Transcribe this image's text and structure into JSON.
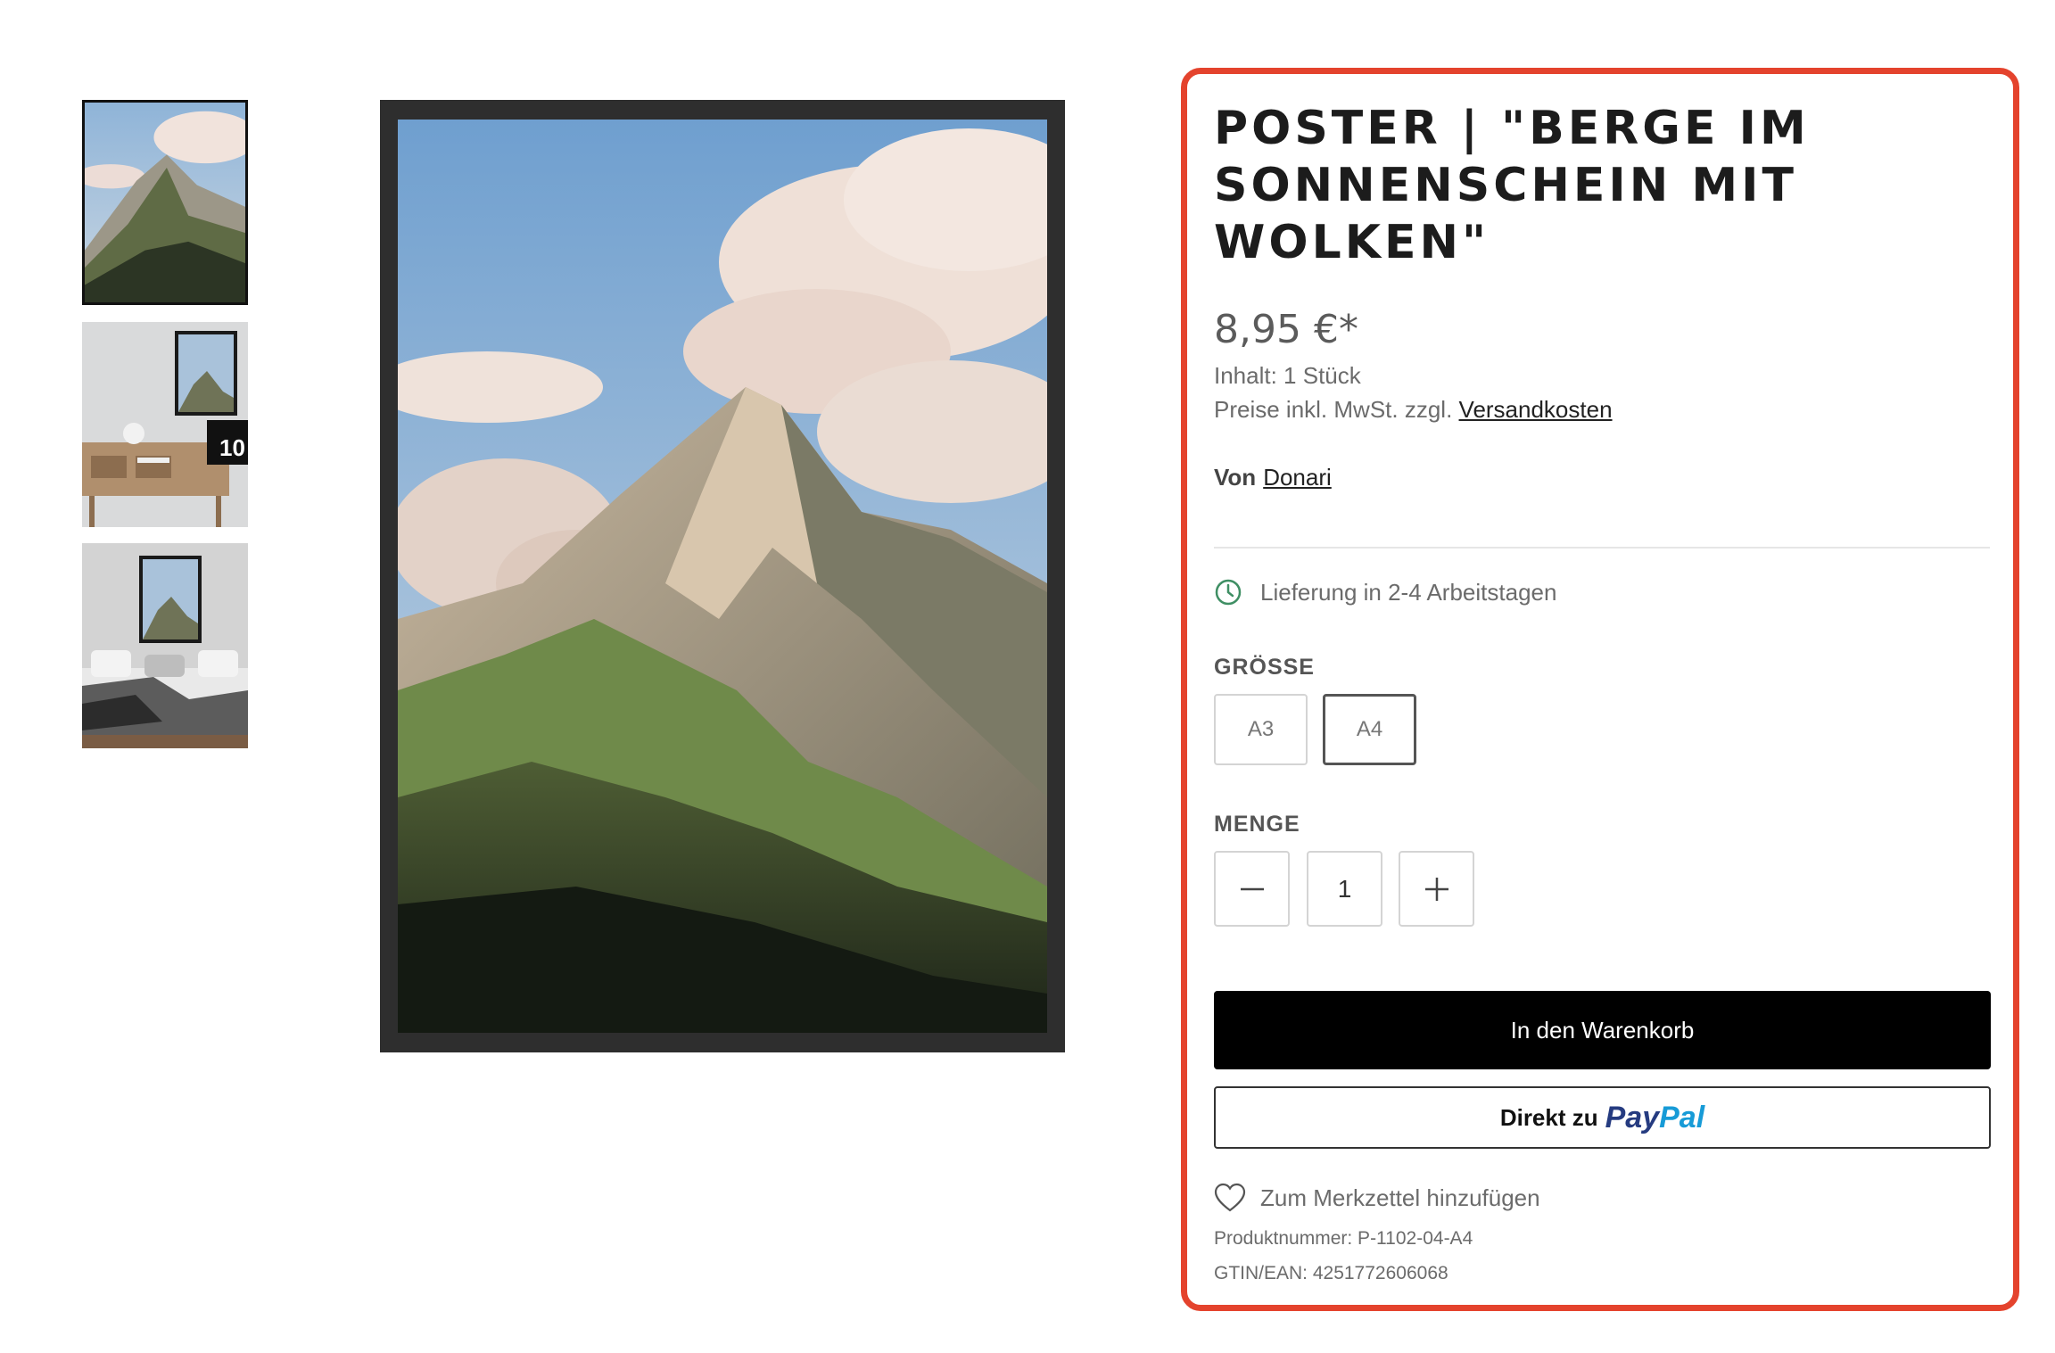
{
  "product": {
    "title": "POSTER | \"BERGE IM SONNENSCHEIN MIT WOLKEN\"",
    "price": "8,95 €*",
    "content": "Inhalt: 1 Stück",
    "tax_note": "Preise inkl. MwSt. zzgl.",
    "shipping_link": "Versandkosten",
    "vendor_label": "Von",
    "vendor_name": "Donari",
    "delivery": "Lieferung in 2-4 Arbeitstagen",
    "size_label": "GRÖSSE",
    "sizes": [
      "A3",
      "A4"
    ],
    "selected_size": "A4",
    "quantity_label": "MENGE",
    "quantity": "1",
    "add_to_cart": "In den Warenkorb",
    "paypal_prefix": "Direkt zu",
    "paypal_pay": "Pay",
    "paypal_pal": "Pal",
    "wishlist": "Zum Merkzettel hinzufügen",
    "product_number": "Produktnummer: P-1102-04-A4",
    "gtin": "GTIN/EAN: 4251772606068"
  },
  "thumbnails": [
    {
      "name": "mountain-poster",
      "active": true
    },
    {
      "name": "poster-on-desk-scene",
      "active": false,
      "badge": "10"
    },
    {
      "name": "poster-above-bed-scene",
      "active": false
    }
  ],
  "colors": {
    "highlight_border": "#e4432d",
    "cart_button": "#000000",
    "paypal_dark": "#253b80",
    "paypal_light": "#179bd7",
    "delivery_icon": "#3f8f64"
  },
  "icons": [
    "clock-icon",
    "minus-icon",
    "plus-icon",
    "heart-icon"
  ]
}
